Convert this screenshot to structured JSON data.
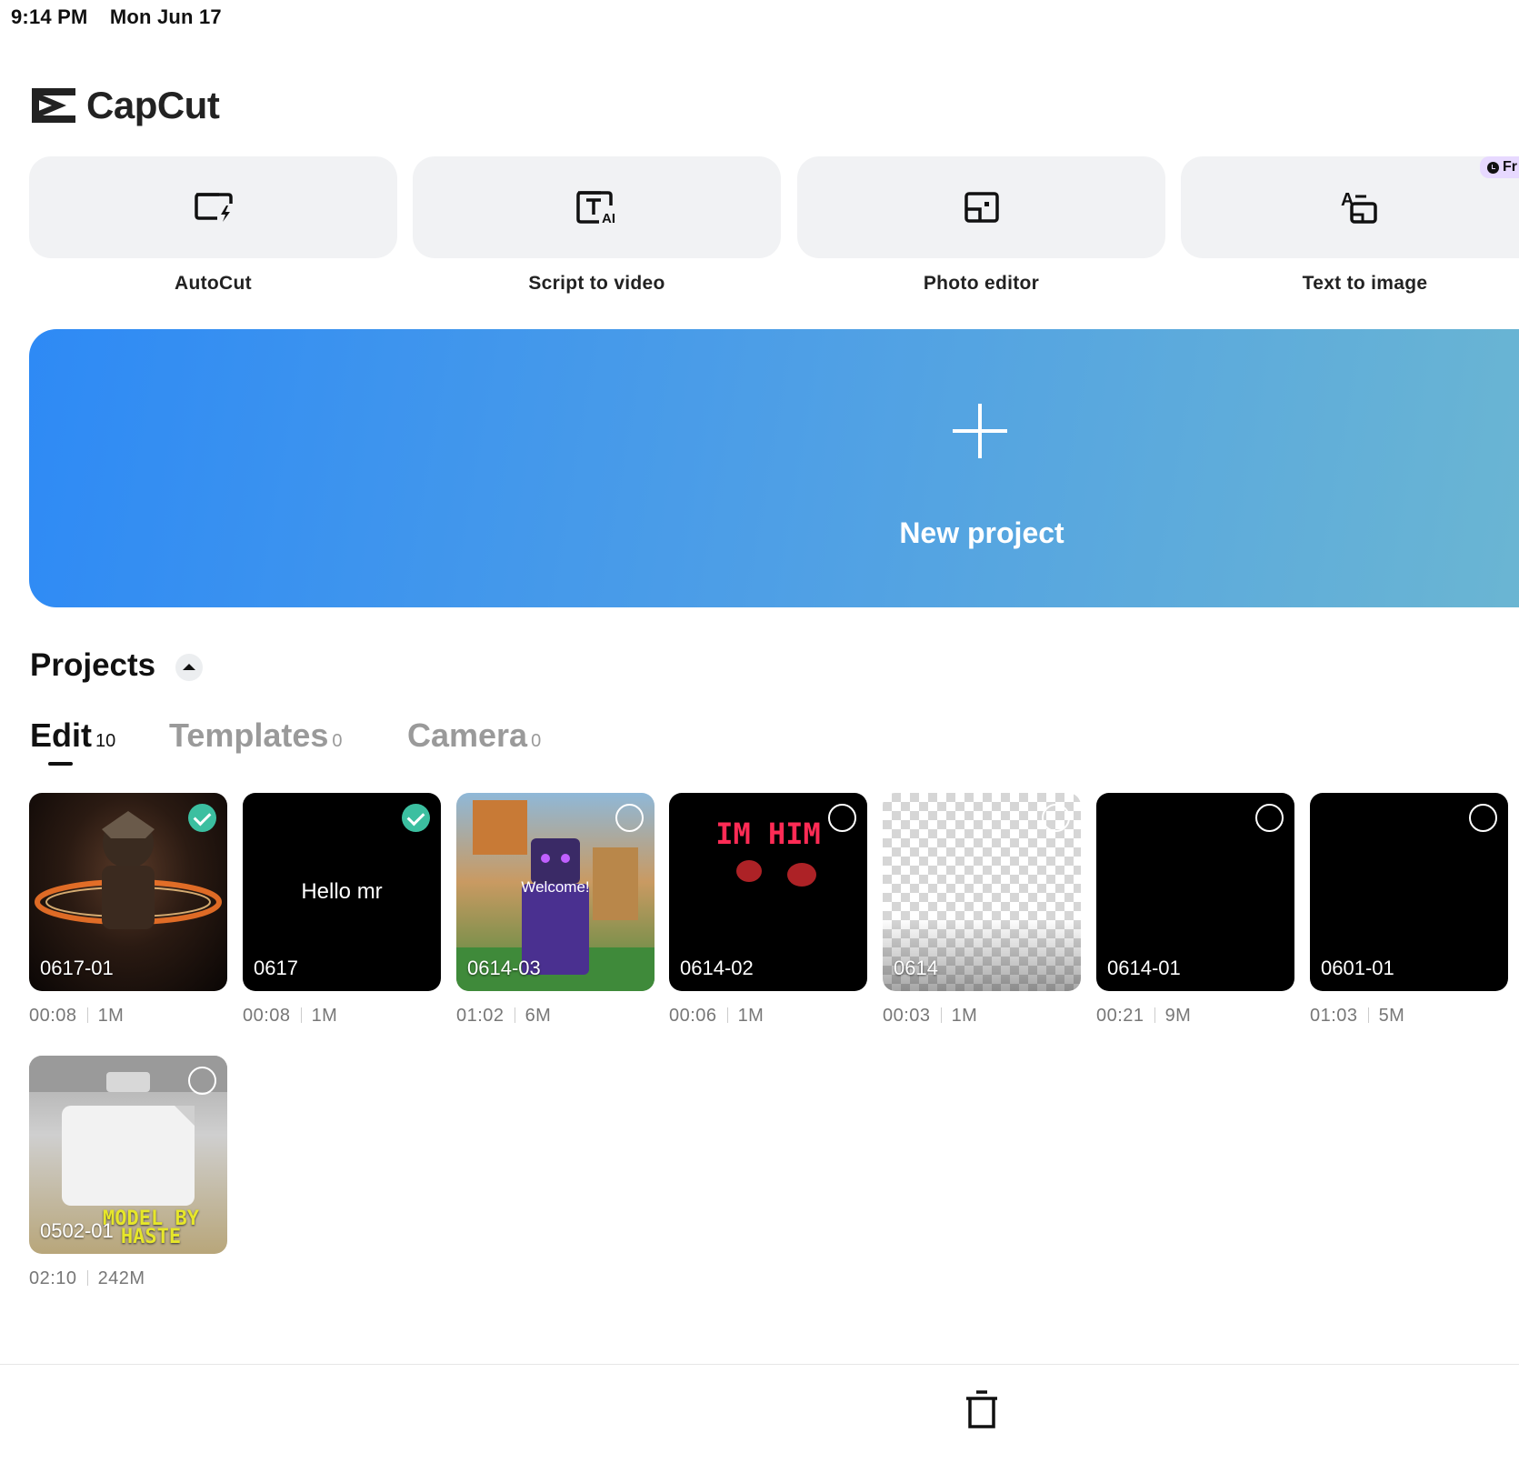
{
  "status_bar": {
    "time": "9:14 PM",
    "date": "Mon Jun 17"
  },
  "app": {
    "name": "CapCut"
  },
  "tools": [
    {
      "label": "AutoCut",
      "icon": "autocut-icon"
    },
    {
      "label": "Script to video",
      "icon": "script-to-video-icon"
    },
    {
      "label": "Photo editor",
      "icon": "photo-editor-icon"
    },
    {
      "label": "Text to image",
      "icon": "text-to-image-icon",
      "badge": "Fr"
    }
  ],
  "new_project": {
    "label": "New project",
    "icon": "plus-icon"
  },
  "projects": {
    "title": "Projects",
    "tabs": [
      {
        "label": "Edit",
        "count": "10",
        "active": true
      },
      {
        "label": "Templates",
        "count": "0",
        "active": false
      },
      {
        "label": "Camera",
        "count": "0",
        "active": false
      }
    ],
    "items": [
      {
        "name": "0617-01",
        "duration": "00:08",
        "size": "1M",
        "selected": true
      },
      {
        "name": "0617",
        "duration": "00:08",
        "size": "1M",
        "selected": true,
        "overlay_text": "Hello mr"
      },
      {
        "name": "0614-03",
        "duration": "01:02",
        "size": "6M",
        "selected": false,
        "overlay_text": "Welcome!"
      },
      {
        "name": "0614-02",
        "duration": "00:06",
        "size": "1M",
        "selected": false,
        "overlay_text": "IM HIM"
      },
      {
        "name": "0614",
        "duration": "00:03",
        "size": "1M",
        "selected": false
      },
      {
        "name": "0614-01",
        "duration": "00:21",
        "size": "9M",
        "selected": false
      },
      {
        "name": "0601-01",
        "duration": "01:03",
        "size": "5M",
        "selected": false
      },
      {
        "name": "0502-01",
        "duration": "02:10",
        "size": "242M",
        "selected": false,
        "overlay_text": "MODEL BY HASTE"
      }
    ]
  },
  "toolbar": {
    "delete_icon": "trash-icon"
  },
  "colors": {
    "check": "#3bbfa0",
    "banner_start": "#2e8af5",
    "banner_end": "#6bb6d2"
  }
}
